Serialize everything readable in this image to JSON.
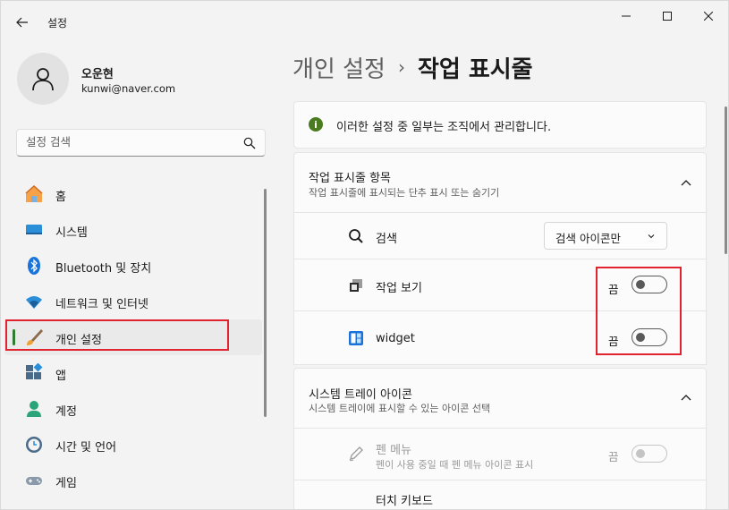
{
  "window": {
    "app_title": "설정"
  },
  "profile": {
    "name": "오운현",
    "email": "kunwi@naver.com"
  },
  "search": {
    "placeholder": "설정 검색"
  },
  "nav": {
    "items": [
      {
        "label": "홈",
        "icon": "home-icon"
      },
      {
        "label": "시스템",
        "icon": "system-icon"
      },
      {
        "label": "Bluetooth 및 장치",
        "icon": "bluetooth-icon"
      },
      {
        "label": "네트워크 및 인터넷",
        "icon": "wifi-icon"
      },
      {
        "label": "개인 설정",
        "icon": "brush-icon",
        "active": true
      },
      {
        "label": "앱",
        "icon": "apps-icon"
      },
      {
        "label": "계정",
        "icon": "account-icon"
      },
      {
        "label": "시간 및 언어",
        "icon": "clock-globe-icon"
      },
      {
        "label": "게임",
        "icon": "gamepad-icon"
      }
    ]
  },
  "breadcrumb": {
    "parent": "개인 설정",
    "separator": "›",
    "current": "작업 표시줄"
  },
  "info_banner": {
    "text": "이러한 설정 중 일부는 조직에서 관리합니다."
  },
  "taskbar_items": {
    "title": "작업 표시줄 항목",
    "subtitle": "작업 표시줄에 표시되는 단추 표시 또는 숨기기",
    "search": {
      "label": "검색",
      "value": "검색 아이콘만"
    },
    "task_view": {
      "label": "작업 보기",
      "state_label": "끔",
      "on": false
    },
    "widget": {
      "label": "widget",
      "state_label": "끔",
      "on": false
    }
  },
  "system_tray": {
    "title": "시스템 트레이 아이콘",
    "subtitle": "시스템 트레이에 표시할 수 있는 아이콘 선택",
    "pen_menu": {
      "label": "펜 메뉴",
      "subtitle": "펜이 사용 중일 때 펜 메뉴 아이콘 표시",
      "state_label": "끔",
      "on": false,
      "disabled": true
    },
    "touch_keyboard": {
      "label": "터치 키보드"
    }
  },
  "colors": {
    "accent_green": "#2e7d32",
    "highlight_red": "#e0232e",
    "info_green": "#4a7c1f"
  }
}
